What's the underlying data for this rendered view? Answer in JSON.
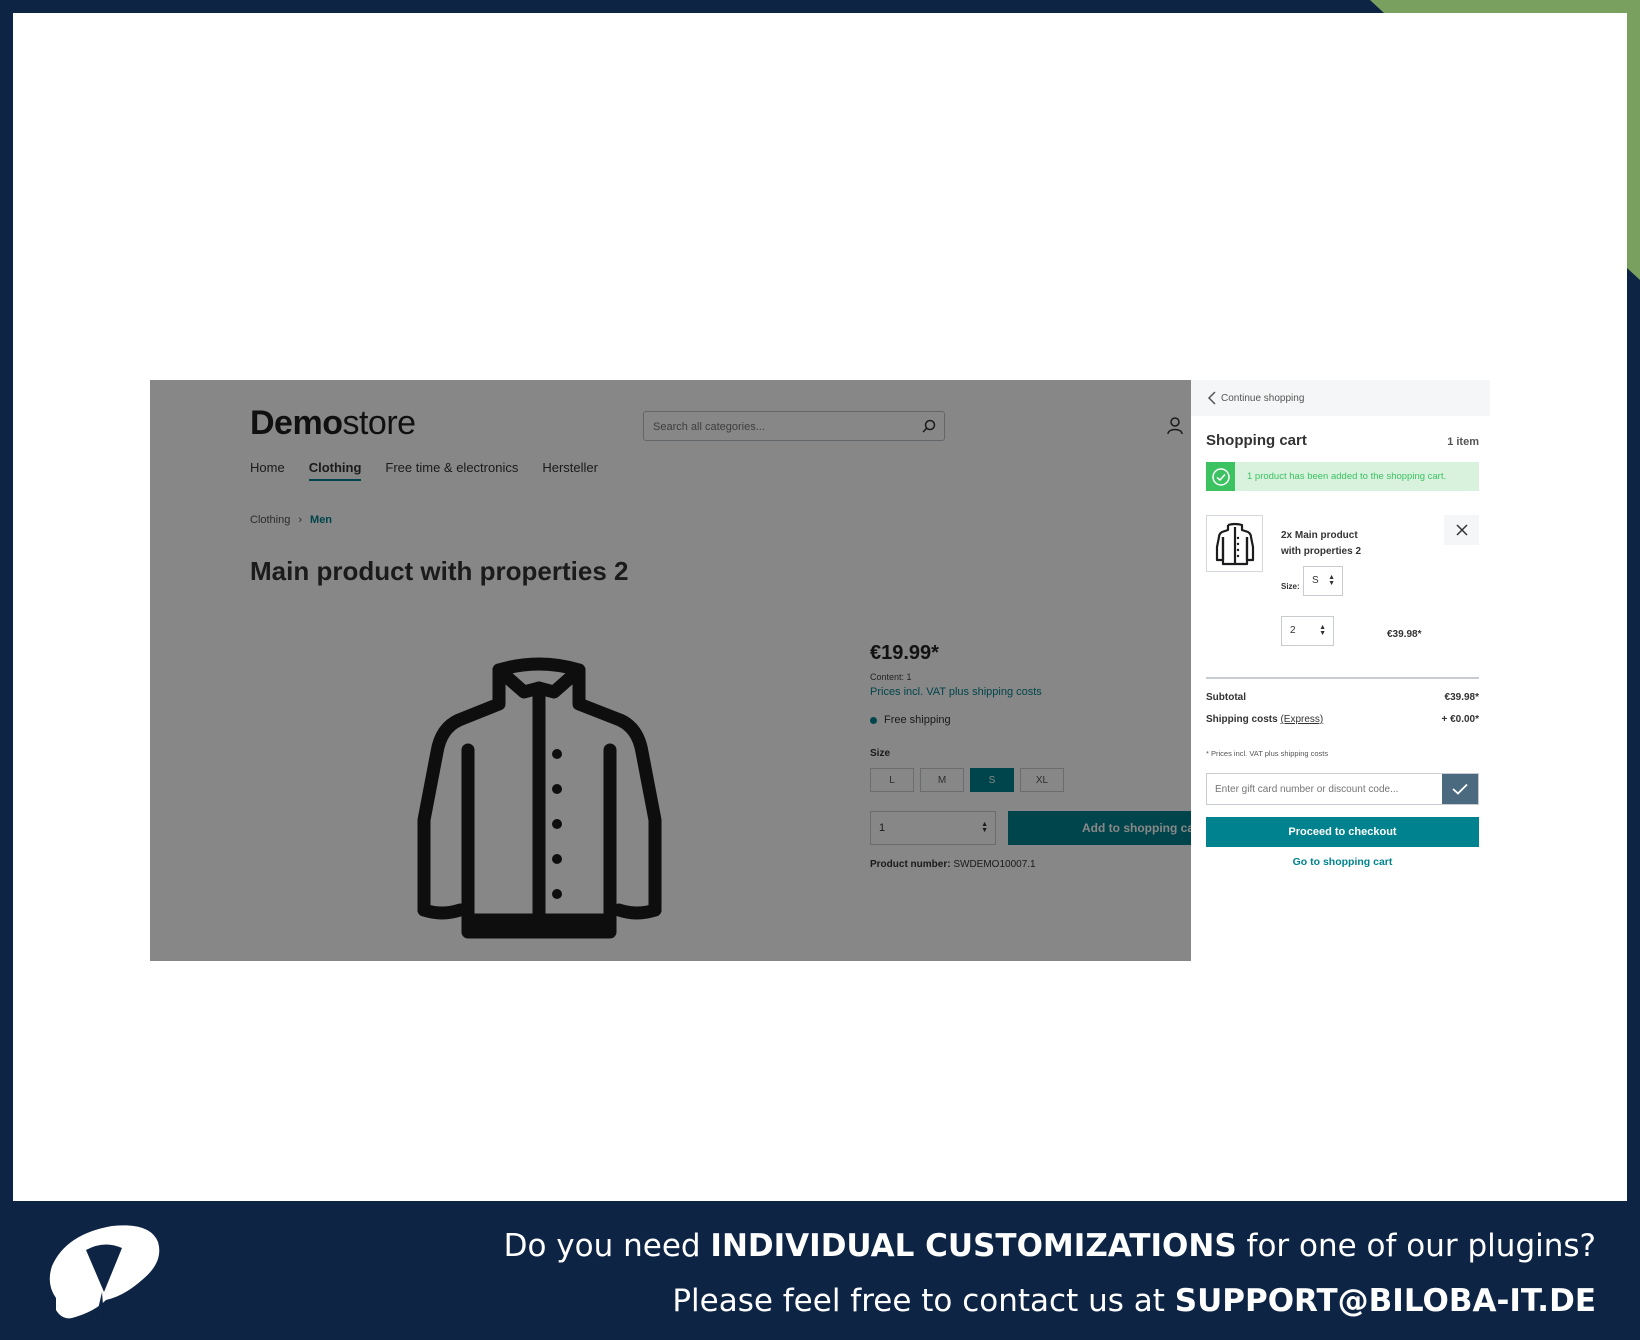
{
  "colors": {
    "navy": "#0d2444",
    "teal": "#00838f",
    "green": "#3cc261",
    "accent": "#7aa060"
  },
  "store": {
    "logo_bold": "Demo",
    "logo_light": "store",
    "search_placeholder": "Search all categories...",
    "nav": [
      "Home",
      "Clothing",
      "Free time & electronics",
      "Hersteller"
    ],
    "active_nav": "Clothing",
    "breadcrumb": [
      "Clothing",
      "Men"
    ],
    "product_title": "Main product with properties 2",
    "price": "€19.99*",
    "content": "Content: 1",
    "vat_note": "Prices incl. VAT plus shipping costs",
    "shipping": "Free shipping",
    "size_label": "Size",
    "sizes": [
      "L",
      "M",
      "S",
      "XL"
    ],
    "selected_size": "S",
    "quantity": "1",
    "add_to_cart": "Add to shopping cart",
    "product_number_label": "Product number:",
    "product_number": "SWDEMO10007.1"
  },
  "cart": {
    "continue": "Continue shopping",
    "title": "Shopping cart",
    "count": "1 item",
    "alert": "1 product has been added to the shopping cart.",
    "item_name_line1": "2x Main product",
    "item_name_line2": "with properties 2",
    "size_label": "Size:",
    "size_value": "S",
    "quantity": "2",
    "item_price": "€39.98*",
    "subtotal_label": "Subtotal",
    "subtotal": "€39.98*",
    "shipping_label": "Shipping costs",
    "shipping_method": "(Express)",
    "shipping_value": "+ €0.00*",
    "note": "* Prices incl. VAT plus shipping costs",
    "code_placeholder": "Enter gift card number or discount code...",
    "checkout": "Proceed to checkout",
    "go_cart": "Go to shopping cart"
  },
  "banner": {
    "line1_pre": "Do you need ",
    "line1_bold": "INDIVIDUAL CUSTOMIZATIONS",
    "line1_post": " for one of our plugins?",
    "line2_pre": "Please feel free to contact us at ",
    "line2_bold": "SUPPORT@BILOBA-IT.DE"
  }
}
